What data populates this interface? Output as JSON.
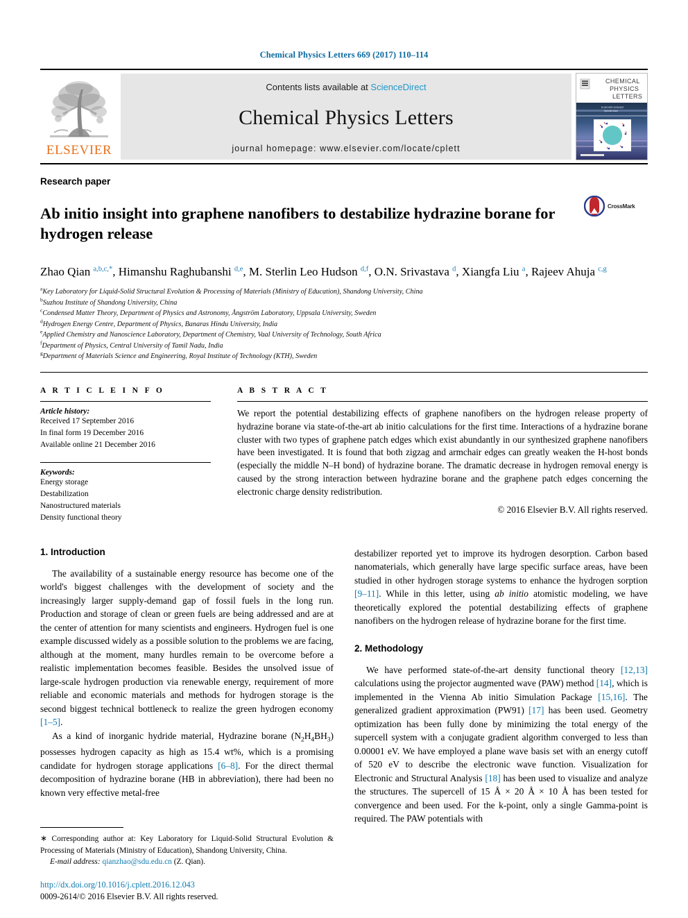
{
  "running_head": "Chemical Physics Letters 669 (2017) 110–114",
  "masthead": {
    "publisher_name": "ELSEVIER",
    "contents_prefix": "Contents lists available at ",
    "contents_link": "ScienceDirect",
    "journal_title": "Chemical Physics Letters",
    "homepage": "journal homepage: www.elsevier.com/locate/cplett",
    "cover": {
      "line1": "CHEMICAL",
      "line2": "PHYSICS",
      "line3": "LETTERS"
    }
  },
  "article": {
    "type": "Research paper",
    "title": "Ab initio insight into graphene nanofibers to destabilize hydrazine borane for hydrogen release",
    "crossmark_label": "CrossMark",
    "authors_html": "Zhao Qian <sup>a,b,c,</sup><sup>*</sup>, Himanshu Raghubanshi <sup>d,e</sup>, M. Sterlin Leo Hudson <sup>d,f</sup>, O.N. Srivastava <sup>d</sup>, Xiangfa Liu <sup>a</sup>, Rajeev Ahuja <sup>c,g</sup>",
    "affiliations": [
      {
        "mark": "a",
        "text": "Key Laboratory for Liquid-Solid Structural Evolution & Processing of Materials (Ministry of Education), Shandong University, China"
      },
      {
        "mark": "b",
        "text": "Suzhou Institute of Shandong University, China"
      },
      {
        "mark": "c",
        "text": "Condensed Matter Theory, Department of Physics and Astronomy, Ångström Laboratory, Uppsala University, Sweden"
      },
      {
        "mark": "d",
        "text": "Hydrogen Energy Centre, Department of Physics, Banaras Hindu University, India"
      },
      {
        "mark": "e",
        "text": "Applied Chemistry and Nanoscience Laboratory, Department of Chemistry, Vaal University of Technology, South Africa"
      },
      {
        "mark": "f",
        "text": "Department of Physics, Central University of Tamil Nadu, India"
      },
      {
        "mark": "g",
        "text": "Department of Materials Science and Engineering, Royal Institute of Technology (KTH), Sweden"
      }
    ]
  },
  "article_info": {
    "heading": "A R T I C L E   I N F O",
    "history_label": "Article history:",
    "history": [
      "Received 17 September 2016",
      "In final form 19 December 2016",
      "Available online 21 December 2016"
    ],
    "keywords_label": "Keywords:",
    "keywords": [
      "Energy storage",
      "Destabilization",
      "Nanostructured materials",
      "Density functional theory"
    ]
  },
  "abstract": {
    "heading": "A B S T R A C T",
    "text": "We report the potential destabilizing effects of graphene nanofibers on the hydrogen release property of hydrazine borane via state-of-the-art ab initio calculations for the first time. Interactions of a hydrazine borane cluster with two types of graphene patch edges which exist abundantly in our synthesized graphene nanofibers have been investigated. It is found that both zigzag and armchair edges can greatly weaken the H-host bonds (especially the middle N–H bond) of hydrazine borane. The dramatic decrease in hydrogen removal energy is caused by the strong interaction between hydrazine borane and the graphene patch edges concerning the electronic charge density redistribution.",
    "copyright": "© 2016 Elsevier B.V. All rights reserved."
  },
  "body": {
    "intro_heading": "1. Introduction",
    "intro_p1_html": "The availability of a sustainable energy resource has become one of the world's biggest challenges with the development of society and the increasingly larger supply-demand gap of fossil fuels in the long run. Production and storage of clean or green fuels are being addressed and are at the center of attention for many scientists and engineers. Hydrogen fuel is one example discussed widely as a possible solution to the problems we are facing, although at the moment, many hurdles remain to be overcome before a realistic implementation becomes feasible. Besides the unsolved issue of large-scale hydrogen production via renewable energy, requirement of more reliable and economic materials and methods for hydrogen storage is the second biggest technical bottleneck to realize the green hydrogen economy <span class=\"ref\">[1–5]</span>.",
    "intro_p2_html": "As a kind of inorganic hydride material, Hydrazine borane (N<sub>2</sub>H<sub>4</sub>BH<sub>3</sub>) possesses hydrogen capacity as high as 15.4 wt%, which is a promising candidate for hydrogen storage applications <span class=\"ref\">[6–8]</span>. For the direct thermal decomposition of hydrazine borane (HB in abbreviation), there had been no known very effective metal-free",
    "intro_p3_html": "destabilizer reported yet to improve its hydrogen desorption. Carbon based nanomaterials, which generally have large specific surface areas, have been studied in other hydrogen storage systems to enhance the hydrogen sorption <span class=\"ref\">[9–11]</span>. While in this letter, using <em>ab initio</em> atomistic modeling, we have theoretically explored the potential destabilizing effects of graphene nanofibers on the hydrogen release of hydrazine borane for the first time.",
    "method_heading": "2. Methodology",
    "method_p1_html": "We have performed state-of-the-art density functional theory <span class=\"ref\">[12,13]</span> calculations using the projector augmented wave (PAW) method <span class=\"ref\">[14]</span>, which is implemented in the Vienna Ab initio Simulation Package <span class=\"ref\">[15,16]</span>. The generalized gradient approximation (PW91) <span class=\"ref\">[17]</span> has been used. Geometry optimization has been fully done by minimizing the total energy of the supercell system with a conjugate gradient algorithm converged to less than 0.00001 eV. We have employed a plane wave basis set with an energy cutoff of 520 eV to describe the electronic wave function. Visualization for Electronic and Structural Analysis <span class=\"ref\">[18]</span> has been used to visualize and analyze the structures. The supercell of 15 Å × 20 Å × 10 Å has been tested for convergence and been used. For the k-point, only a single Gamma-point is required. The PAW potentials with"
  },
  "footnote": {
    "corresponding_html": "<span class=\"star\">∗</span> Corresponding author at: Key Laboratory for Liquid-Solid Structural Evolution & Processing of Materials (Ministry of Education), Shandong University, China.",
    "email_label": "E-mail address:",
    "email": "qianzhao@sdu.edu.cn",
    "email_suffix": "(Z. Qian)."
  },
  "footer": {
    "doi": "http://dx.doi.org/10.1016/j.cplett.2016.12.043",
    "issn_line": "0009-2614/© 2016 Elsevier B.V. All rights reserved."
  },
  "colors": {
    "link": "#0f7ab0",
    "elsevier_orange": "#E9711C",
    "sciencedirect": "#2196c9",
    "masthead_bg": "#e6e6e6"
  }
}
